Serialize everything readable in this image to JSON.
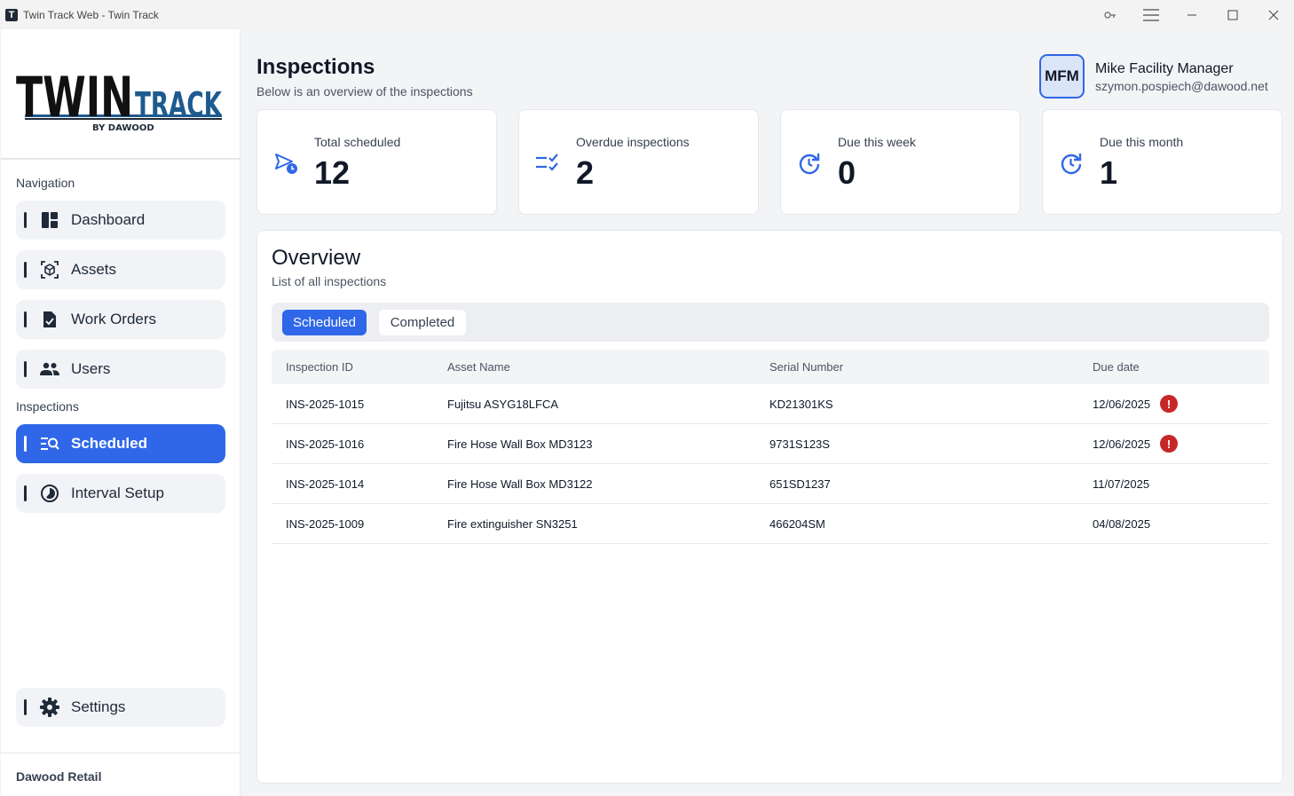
{
  "window": {
    "title": "Twin Track Web - Twin Track",
    "app_icon_letter": "T"
  },
  "logo": {
    "line1": "TWIN",
    "line2": "TRACK",
    "byline": "BY DAWOOD"
  },
  "sidebar": {
    "section_navigation": "Navigation",
    "nav_items": [
      {
        "label": "Dashboard",
        "icon": "dashboard-icon"
      },
      {
        "label": "Assets",
        "icon": "assets-icon"
      },
      {
        "label": "Work Orders",
        "icon": "work-orders-icon"
      },
      {
        "label": "Users",
        "icon": "users-icon"
      }
    ],
    "section_inspections": "Inspections",
    "inspection_items": [
      {
        "label": "Scheduled",
        "icon": "scheduled-icon",
        "active": true
      },
      {
        "label": "Interval Setup",
        "icon": "interval-icon",
        "active": false
      }
    ],
    "settings_label": "Settings",
    "org_name": "Dawood Retail"
  },
  "header": {
    "title": "Inspections",
    "subtitle": "Below is an overview of the inspections",
    "user": {
      "initials": "MFM",
      "name": "Mike Facility Manager",
      "email": "szymon.pospiech@dawood.net"
    }
  },
  "stats": [
    {
      "label": "Total scheduled",
      "value": "12",
      "icon": "scheduled-send-icon"
    },
    {
      "label": "Overdue inspections",
      "value": "2",
      "icon": "checklist-icon"
    },
    {
      "label": "Due this week",
      "value": "0",
      "icon": "refresh-clock-icon"
    },
    {
      "label": "Due this month",
      "value": "1",
      "icon": "refresh-clock-icon"
    }
  ],
  "overview": {
    "title": "Overview",
    "subtitle": "List of all inspections",
    "tabs": [
      "Scheduled",
      "Completed"
    ],
    "columns": [
      "Inspection ID",
      "Asset Name",
      "Serial Number",
      "Due date"
    ],
    "rows": [
      {
        "id": "INS-2025-1015",
        "asset": "Fujitsu ASYG18LFCA",
        "serial": "KD21301KS",
        "due": "12/06/2025",
        "overdue": true
      },
      {
        "id": "INS-2025-1016",
        "asset": "Fire Hose Wall Box MD3123",
        "serial": "9731S123S",
        "due": "12/06/2025",
        "overdue": true
      },
      {
        "id": "INS-2025-1014",
        "asset": "Fire Hose Wall Box MD3122",
        "serial": "651SD1237",
        "due": "11/07/2025",
        "overdue": false
      },
      {
        "id": "INS-2025-1009",
        "asset": "Fire extinguisher SN3251",
        "serial": "466204SM",
        "due": "04/08/2025",
        "overdue": false
      }
    ]
  },
  "colors": {
    "accent": "#2f67e8",
    "danger": "#c62828",
    "brand_blue": "#1d5b8f"
  }
}
